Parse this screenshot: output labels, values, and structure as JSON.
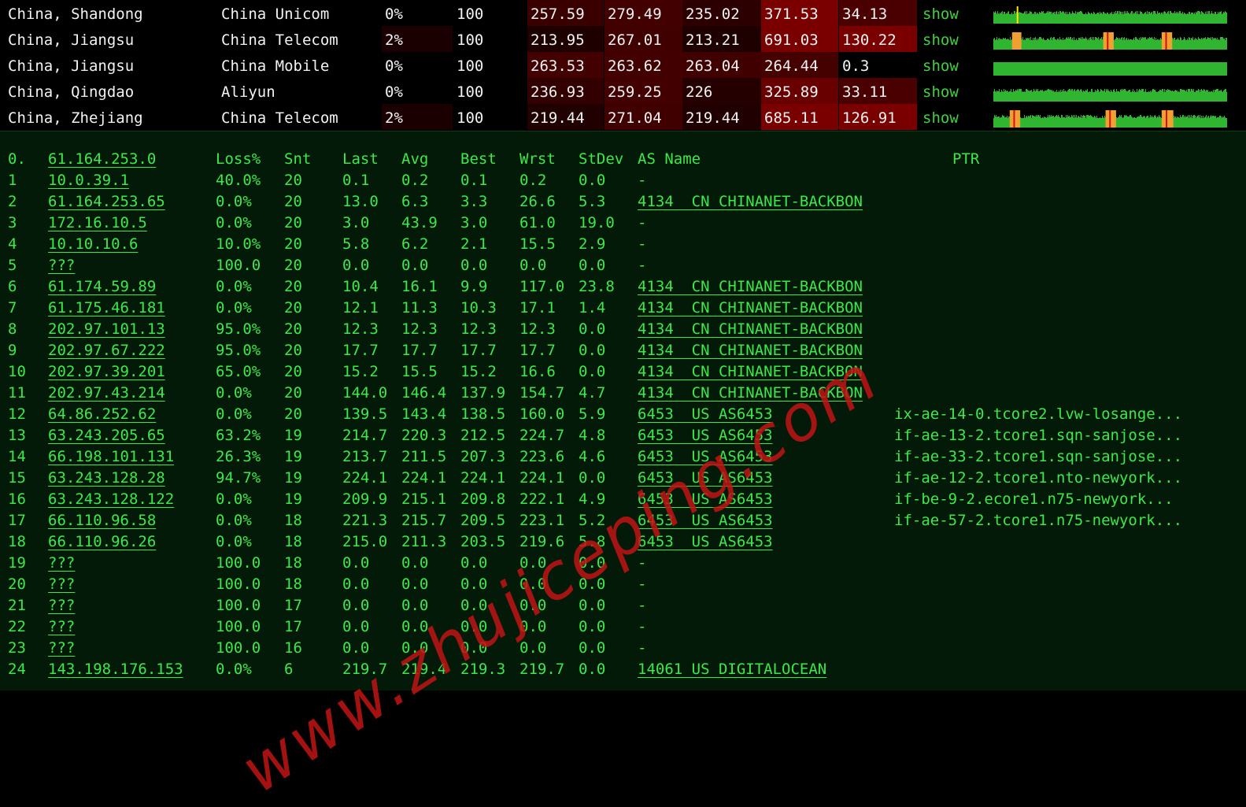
{
  "ping_rows": [
    {
      "location": "China, Shandong",
      "isp": "China Unicom",
      "loss": "0%",
      "sent": "100",
      "last": "257.59",
      "avg": "279.49",
      "best": "235.02",
      "worst": "371.53",
      "stdev": "34.13",
      "link": "show",
      "spark": {
        "base": "#2fb52f",
        "marks": [
          {
            "pos": 0.1,
            "color": "#ffe600",
            "w": 0.006
          }
        ]
      }
    },
    {
      "location": "China, Jiangsu",
      "isp": "China Telecom",
      "loss": "2%",
      "sent": "100",
      "last": "213.95",
      "avg": "267.01",
      "best": "213.21",
      "worst": "691.03",
      "stdev": "130.22",
      "link": "show",
      "spark": {
        "base": "#2fb52f",
        "marks": [
          {
            "pos": 0.08,
            "color": "#f0a030",
            "w": 0.04
          },
          {
            "pos": 0.47,
            "color": "#f0a030",
            "w": 0.045
          },
          {
            "pos": 0.72,
            "color": "#f0a030",
            "w": 0.045
          }
        ]
      }
    },
    {
      "location": "China, Jiangsu",
      "isp": "China Mobile",
      "loss": "0%",
      "sent": "100",
      "last": "263.53",
      "avg": "263.62",
      "best": "263.04",
      "worst": "264.44",
      "stdev": "0.3",
      "link": "show",
      "spark": {
        "base": "#2fb52f",
        "marks": []
      }
    },
    {
      "location": "China, Qingdao",
      "isp": "Aliyun",
      "loss": "0%",
      "sent": "100",
      "last": "236.93",
      "avg": "259.25",
      "best": "226",
      "worst": "325.89",
      "stdev": "33.11",
      "link": "show",
      "spark": {
        "base": "#2fb52f",
        "marks": []
      }
    },
    {
      "location": "China, Zhejiang",
      "isp": "China Telecom",
      "loss": "2%",
      "sent": "100",
      "last": "219.44",
      "avg": "271.04",
      "best": "219.44",
      "worst": "685.11",
      "stdev": "126.91",
      "link": "show",
      "spark": {
        "base": "#2fb52f",
        "marks": [
          {
            "pos": 0.07,
            "color": "#f0a030",
            "w": 0.045
          },
          {
            "pos": 0.48,
            "color": "#f0a030",
            "w": 0.045
          },
          {
            "pos": 0.72,
            "color": "#f0a030",
            "w": 0.05
          }
        ]
      }
    }
  ],
  "ping_colors": {
    "loss_2pct": "#1a0000",
    "last_row0": "#3a0000",
    "last_row1": "#1e0000",
    "last_row2": "#420000",
    "last_row3": "#330000",
    "last_row4": "#200000",
    "avg_row0": "#430000",
    "avg_row1": "#400000",
    "avg_row2": "#420000",
    "avg_row3": "#420000",
    "avg_row4": "#410000",
    "best_row0": "#2c0000",
    "best_row1": "#1e0000",
    "best_row2": "#410000",
    "best_row3": "#240000",
    "best_row4": "#200000",
    "worst_row0": "#7a0000",
    "worst_row1": "#7a0000",
    "worst_row2": "#450000",
    "worst_row3": "#680000",
    "worst_row4": "#7a0000",
    "stdev_row0": "#4a0000",
    "stdev_row1": "#7a0000",
    "stdev_row2": "#000000",
    "stdev_row3": "#4a0000",
    "stdev_row4": "#7a0000"
  },
  "mtr": {
    "header": {
      "idx": "0.",
      "host": "61.164.253.0",
      "loss": "Loss%",
      "snt": "Snt",
      "last": "Last",
      "avg": "Avg",
      "best": "Best",
      "wrst": "Wrst",
      "stdev": "StDev",
      "asname": "AS Name",
      "ptr": "PTR"
    },
    "hops": [
      {
        "idx": "1",
        "host": "10.0.39.1",
        "loss": "40.0%",
        "snt": "20",
        "last": "0.1",
        "avg": "0.2",
        "best": "0.1",
        "wrst": "0.2",
        "stdev": "0.0",
        "as": "-",
        "as_link": false,
        "ptr": ""
      },
      {
        "idx": "2",
        "host": "61.164.253.65",
        "loss": "0.0%",
        "snt": "20",
        "last": "13.0",
        "avg": "6.3",
        "best": "3.3",
        "wrst": "26.6",
        "stdev": "5.3",
        "as": "4134  CN CHINANET-BACKBON",
        "as_link": true,
        "ptr": ""
      },
      {
        "idx": "3",
        "host": "172.16.10.5",
        "loss": "0.0%",
        "snt": "20",
        "last": "3.0",
        "avg": "43.9",
        "best": "3.0",
        "wrst": "61.0",
        "stdev": "19.0",
        "as": "-",
        "as_link": false,
        "ptr": ""
      },
      {
        "idx": "4",
        "host": "10.10.10.6",
        "loss": "10.0%",
        "snt": "20",
        "last": "5.8",
        "avg": "6.2",
        "best": "2.1",
        "wrst": "15.5",
        "stdev": "2.9",
        "as": "-",
        "as_link": false,
        "ptr": ""
      },
      {
        "idx": "5",
        "host": "???",
        "loss": "100.0",
        "snt": "20",
        "last": "0.0",
        "avg": "0.0",
        "best": "0.0",
        "wrst": "0.0",
        "stdev": "0.0",
        "as": "-",
        "as_link": false,
        "ptr": ""
      },
      {
        "idx": "6",
        "host": "61.174.59.89",
        "loss": "0.0%",
        "snt": "20",
        "last": "10.4",
        "avg": "16.1",
        "best": "9.9",
        "wrst": "117.0",
        "stdev": "23.8",
        "as": "4134  CN CHINANET-BACKBON",
        "as_link": true,
        "ptr": ""
      },
      {
        "idx": "7",
        "host": "61.175.46.181",
        "loss": "0.0%",
        "snt": "20",
        "last": "12.1",
        "avg": "11.3",
        "best": "10.3",
        "wrst": "17.1",
        "stdev": "1.4",
        "as": "4134  CN CHINANET-BACKBON",
        "as_link": true,
        "ptr": ""
      },
      {
        "idx": "8",
        "host": "202.97.101.13",
        "loss": "95.0%",
        "snt": "20",
        "last": "12.3",
        "avg": "12.3",
        "best": "12.3",
        "wrst": "12.3",
        "stdev": "0.0",
        "as": "4134  CN CHINANET-BACKBON",
        "as_link": true,
        "ptr": ""
      },
      {
        "idx": "9",
        "host": "202.97.67.222",
        "loss": "95.0%",
        "snt": "20",
        "last": "17.7",
        "avg": "17.7",
        "best": "17.7",
        "wrst": "17.7",
        "stdev": "0.0",
        "as": "4134  CN CHINANET-BACKBON",
        "as_link": true,
        "ptr": ""
      },
      {
        "idx": "10",
        "host": "202.97.39.201",
        "loss": "65.0%",
        "snt": "20",
        "last": "15.2",
        "avg": "15.5",
        "best": "15.2",
        "wrst": "16.6",
        "stdev": "0.0",
        "as": "4134  CN CHINANET-BACKBON",
        "as_link": true,
        "ptr": ""
      },
      {
        "idx": "11",
        "host": "202.97.43.214",
        "loss": "0.0%",
        "snt": "20",
        "last": "144.0",
        "avg": "146.4",
        "best": "137.9",
        "wrst": "154.7",
        "stdev": "4.7",
        "as": "4134  CN CHINANET-BACKBON",
        "as_link": true,
        "ptr": ""
      },
      {
        "idx": "12",
        "host": "64.86.252.62",
        "loss": "0.0%",
        "snt": "20",
        "last": "139.5",
        "avg": "143.4",
        "best": "138.5",
        "wrst": "160.0",
        "stdev": "5.9",
        "as": "6453  US AS6453",
        "as_link": true,
        "ptr": "ix-ae-14-0.tcore2.lvw-losange..."
      },
      {
        "idx": "13",
        "host": "63.243.205.65",
        "loss": "63.2%",
        "snt": "19",
        "last": "214.7",
        "avg": "220.3",
        "best": "212.5",
        "wrst": "224.7",
        "stdev": "4.8",
        "as": "6453  US AS6453",
        "as_link": true,
        "ptr": "if-ae-13-2.tcore1.sqn-sanjose..."
      },
      {
        "idx": "14",
        "host": "66.198.101.131",
        "loss": "26.3%",
        "snt": "19",
        "last": "213.7",
        "avg": "211.5",
        "best": "207.3",
        "wrst": "223.6",
        "stdev": "4.6",
        "as": "6453  US AS6453",
        "as_link": true,
        "ptr": "if-ae-33-2.tcore1.sqn-sanjose..."
      },
      {
        "idx": "15",
        "host": "63.243.128.28",
        "loss": "94.7%",
        "snt": "19",
        "last": "224.1",
        "avg": "224.1",
        "best": "224.1",
        "wrst": "224.1",
        "stdev": "0.0",
        "as": "6453  US AS6453",
        "as_link": true,
        "ptr": "if-ae-12-2.tcore1.nto-newyork..."
      },
      {
        "idx": "16",
        "host": "63.243.128.122",
        "loss": "0.0%",
        "snt": "19",
        "last": "209.9",
        "avg": "215.1",
        "best": "209.8",
        "wrst": "222.1",
        "stdev": "4.9",
        "as": "6453  US AS6453",
        "as_link": true,
        "ptr": "if-be-9-2.ecore1.n75-newyork..."
      },
      {
        "idx": "17",
        "host": "66.110.96.58",
        "loss": "0.0%",
        "snt": "18",
        "last": "221.3",
        "avg": "215.7",
        "best": "209.5",
        "wrst": "223.1",
        "stdev": "5.2",
        "as": "6453  US AS6453",
        "as_link": true,
        "ptr": "if-ae-57-2.tcore1.n75-newyork..."
      },
      {
        "idx": "18",
        "host": "66.110.96.26",
        "loss": "0.0%",
        "snt": "18",
        "last": "215.0",
        "avg": "211.3",
        "best": "203.5",
        "wrst": "219.6",
        "stdev": "5.8",
        "as": "6453  US AS6453",
        "as_link": true,
        "ptr": ""
      },
      {
        "idx": "19",
        "host": "???",
        "loss": "100.0",
        "snt": "18",
        "last": "0.0",
        "avg": "0.0",
        "best": "0.0",
        "wrst": "0.0",
        "stdev": "0.0",
        "as": "-",
        "as_link": false,
        "ptr": ""
      },
      {
        "idx": "20",
        "host": "???",
        "loss": "100.0",
        "snt": "18",
        "last": "0.0",
        "avg": "0.0",
        "best": "0.0",
        "wrst": "0.0",
        "stdev": "0.0",
        "as": "-",
        "as_link": false,
        "ptr": ""
      },
      {
        "idx": "21",
        "host": "???",
        "loss": "100.0",
        "snt": "17",
        "last": "0.0",
        "avg": "0.0",
        "best": "0.0",
        "wrst": "0.0",
        "stdev": "0.0",
        "as": "-",
        "as_link": false,
        "ptr": ""
      },
      {
        "idx": "22",
        "host": "???",
        "loss": "100.0",
        "snt": "17",
        "last": "0.0",
        "avg": "0.0",
        "best": "0.0",
        "wrst": "0.0",
        "stdev": "0.0",
        "as": "-",
        "as_link": false,
        "ptr": ""
      },
      {
        "idx": "23",
        "host": "???",
        "loss": "100.0",
        "snt": "16",
        "last": "0.0",
        "avg": "0.0",
        "best": "0.0",
        "wrst": "0.0",
        "stdev": "0.0",
        "as": "-",
        "as_link": false,
        "ptr": ""
      },
      {
        "idx": "24",
        "host": "143.198.176.153",
        "loss": "0.0%",
        "snt": "6",
        "last": "219.7",
        "avg": "219.4",
        "best": "219.3",
        "wrst": "219.7",
        "stdev": "0.0",
        "as": "14061 US DIGITALOCEAN",
        "as_link": true,
        "ptr": ""
      }
    ]
  },
  "watermark": "www.zhujiceping.com",
  "colors": {
    "terminal_bg": "#041a08",
    "terminal_text": "#3de84a",
    "show_link": "#3fd13f",
    "watermark": "#c01414"
  }
}
